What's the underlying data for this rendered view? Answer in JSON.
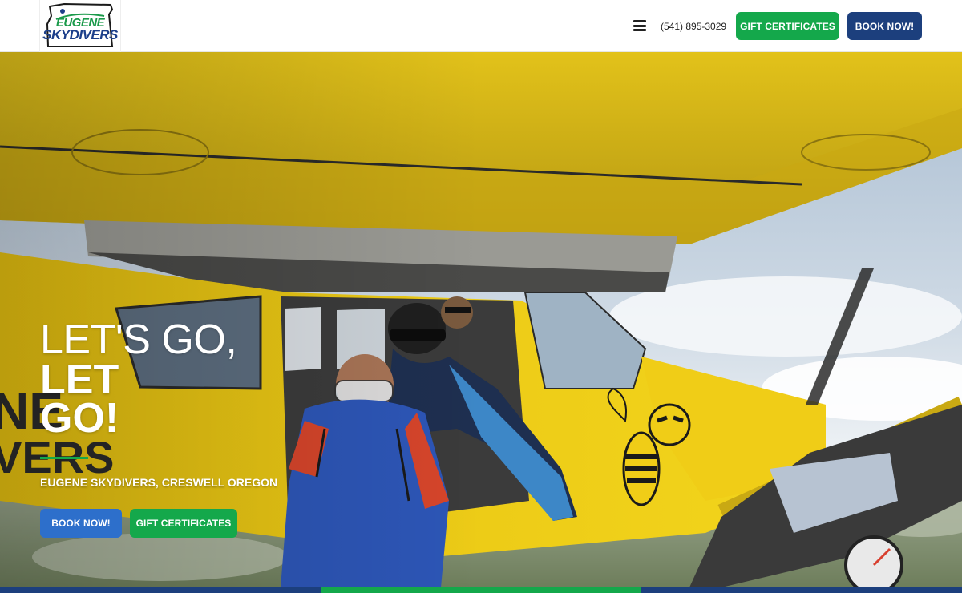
{
  "header": {
    "logo": {
      "line1": "EUGENE",
      "line2": "SKYDIVERS",
      "colors": {
        "green": "#1a9a4a",
        "blue": "#1c3f8a"
      }
    },
    "menu_icon": "hamburger-menu-icon",
    "phone": "(541) 895-3029",
    "gift_button": "GIFT CERTIFICATES",
    "book_button": "BOOK NOW!"
  },
  "hero": {
    "headline_line1": "LET'S GO,",
    "headline_line2": "LET",
    "headline_line3": "GO!",
    "subtitle": "EUGENE SKYDIVERS, CRESWELL OREGON",
    "book_button": "BOOK NOW!",
    "gift_button": "GIFT CERTIFICATES",
    "plane_text": "NE\nVERS"
  },
  "colors": {
    "green": "#14a84b",
    "navy": "#1c3f7d",
    "blue": "#2d6fcb",
    "plane_yellow": "#f2cf16"
  }
}
